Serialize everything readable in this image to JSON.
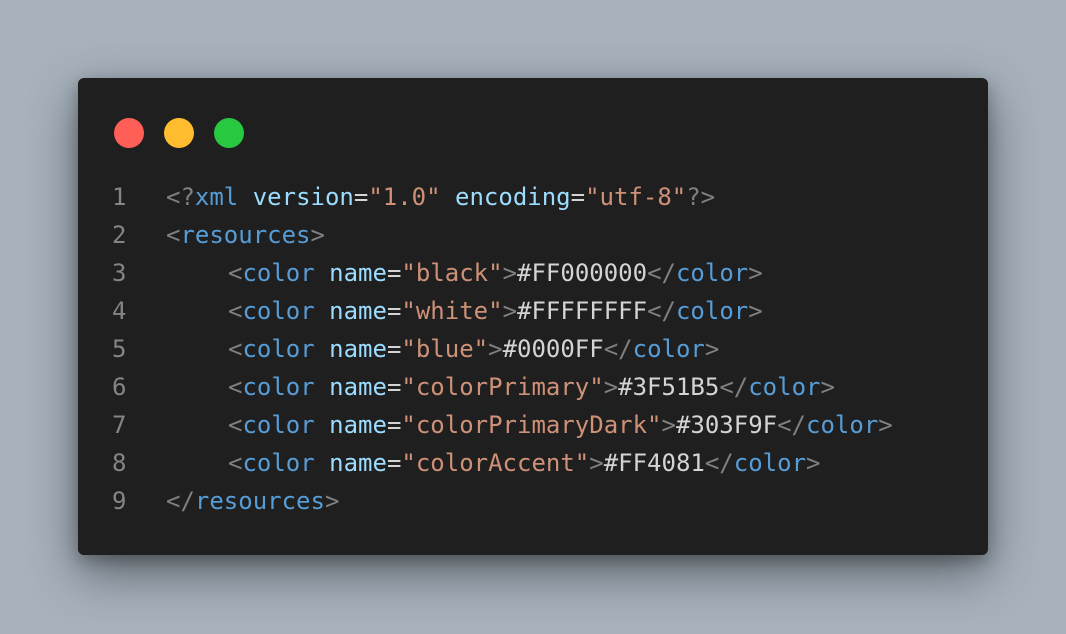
{
  "colors": {
    "background": "#a7b2bd",
    "window": "#1f1f1f",
    "line_number": "#858585",
    "punct": "#808080",
    "tag": "#569cd6",
    "attr": "#9cdcfe",
    "string": "#ce9178",
    "text": "#d4d4d4",
    "traffic_red": "#ff5f57",
    "traffic_yellow": "#febc2e",
    "traffic_green": "#28c840"
  },
  "traffic_lights": [
    {
      "name": "close",
      "color": "#ff5f57"
    },
    {
      "name": "minimize",
      "color": "#febc2e"
    },
    {
      "name": "maximize",
      "color": "#28c840"
    }
  ],
  "code": {
    "lines": [
      {
        "number": "1",
        "indent": false,
        "tokens": [
          {
            "t": "<?",
            "c": "punct"
          },
          {
            "t": "xml",
            "c": "tag"
          },
          {
            "t": " ",
            "c": "text"
          },
          {
            "t": "version",
            "c": "attr"
          },
          {
            "t": "=",
            "c": "text"
          },
          {
            "t": "\"1.0\"",
            "c": "string"
          },
          {
            "t": " ",
            "c": "text"
          },
          {
            "t": "encoding",
            "c": "attr"
          },
          {
            "t": "=",
            "c": "text"
          },
          {
            "t": "\"utf-8\"",
            "c": "string"
          },
          {
            "t": "?>",
            "c": "punct"
          }
        ]
      },
      {
        "number": "2",
        "indent": false,
        "tokens": [
          {
            "t": "<",
            "c": "punct"
          },
          {
            "t": "resources",
            "c": "tag"
          },
          {
            "t": ">",
            "c": "punct"
          }
        ]
      },
      {
        "number": "3",
        "indent": true,
        "tokens": [
          {
            "t": "<",
            "c": "punct"
          },
          {
            "t": "color",
            "c": "tag"
          },
          {
            "t": " ",
            "c": "text"
          },
          {
            "t": "name",
            "c": "attr"
          },
          {
            "t": "=",
            "c": "text"
          },
          {
            "t": "\"black\"",
            "c": "string"
          },
          {
            "t": ">",
            "c": "punct"
          },
          {
            "t": "#FF000000",
            "c": "text"
          },
          {
            "t": "</",
            "c": "punct"
          },
          {
            "t": "color",
            "c": "tag"
          },
          {
            "t": ">",
            "c": "punct"
          }
        ]
      },
      {
        "number": "4",
        "indent": true,
        "tokens": [
          {
            "t": "<",
            "c": "punct"
          },
          {
            "t": "color",
            "c": "tag"
          },
          {
            "t": " ",
            "c": "text"
          },
          {
            "t": "name",
            "c": "attr"
          },
          {
            "t": "=",
            "c": "text"
          },
          {
            "t": "\"white\"",
            "c": "string"
          },
          {
            "t": ">",
            "c": "punct"
          },
          {
            "t": "#FFFFFFFF",
            "c": "text"
          },
          {
            "t": "</",
            "c": "punct"
          },
          {
            "t": "color",
            "c": "tag"
          },
          {
            "t": ">",
            "c": "punct"
          }
        ]
      },
      {
        "number": "5",
        "indent": true,
        "tokens": [
          {
            "t": "<",
            "c": "punct"
          },
          {
            "t": "color",
            "c": "tag"
          },
          {
            "t": " ",
            "c": "text"
          },
          {
            "t": "name",
            "c": "attr"
          },
          {
            "t": "=",
            "c": "text"
          },
          {
            "t": "\"blue\"",
            "c": "string"
          },
          {
            "t": ">",
            "c": "punct"
          },
          {
            "t": "#0000FF",
            "c": "text"
          },
          {
            "t": "</",
            "c": "punct"
          },
          {
            "t": "color",
            "c": "tag"
          },
          {
            "t": ">",
            "c": "punct"
          }
        ]
      },
      {
        "number": "6",
        "indent": true,
        "tokens": [
          {
            "t": "<",
            "c": "punct"
          },
          {
            "t": "color",
            "c": "tag"
          },
          {
            "t": " ",
            "c": "text"
          },
          {
            "t": "name",
            "c": "attr"
          },
          {
            "t": "=",
            "c": "text"
          },
          {
            "t": "\"colorPrimary\"",
            "c": "string"
          },
          {
            "t": ">",
            "c": "punct"
          },
          {
            "t": "#3F51B5",
            "c": "text"
          },
          {
            "t": "</",
            "c": "punct"
          },
          {
            "t": "color",
            "c": "tag"
          },
          {
            "t": ">",
            "c": "punct"
          }
        ]
      },
      {
        "number": "7",
        "indent": true,
        "tokens": [
          {
            "t": "<",
            "c": "punct"
          },
          {
            "t": "color",
            "c": "tag"
          },
          {
            "t": " ",
            "c": "text"
          },
          {
            "t": "name",
            "c": "attr"
          },
          {
            "t": "=",
            "c": "text"
          },
          {
            "t": "\"colorPrimaryDark\"",
            "c": "string"
          },
          {
            "t": ">",
            "c": "punct"
          },
          {
            "t": "#303F9F",
            "c": "text"
          },
          {
            "t": "</",
            "c": "punct"
          },
          {
            "t": "color",
            "c": "tag"
          },
          {
            "t": ">",
            "c": "punct"
          }
        ]
      },
      {
        "number": "8",
        "indent": true,
        "tokens": [
          {
            "t": "<",
            "c": "punct"
          },
          {
            "t": "color",
            "c": "tag"
          },
          {
            "t": " ",
            "c": "text"
          },
          {
            "t": "name",
            "c": "attr"
          },
          {
            "t": "=",
            "c": "text"
          },
          {
            "t": "\"colorAccent\"",
            "c": "string"
          },
          {
            "t": ">",
            "c": "punct"
          },
          {
            "t": "#FF4081",
            "c": "text"
          },
          {
            "t": "</",
            "c": "punct"
          },
          {
            "t": "color",
            "c": "tag"
          },
          {
            "t": ">",
            "c": "punct"
          }
        ]
      },
      {
        "number": "9",
        "indent": false,
        "tokens": [
          {
            "t": "</",
            "c": "punct"
          },
          {
            "t": "resources",
            "c": "tag"
          },
          {
            "t": ">",
            "c": "punct"
          }
        ]
      }
    ]
  }
}
